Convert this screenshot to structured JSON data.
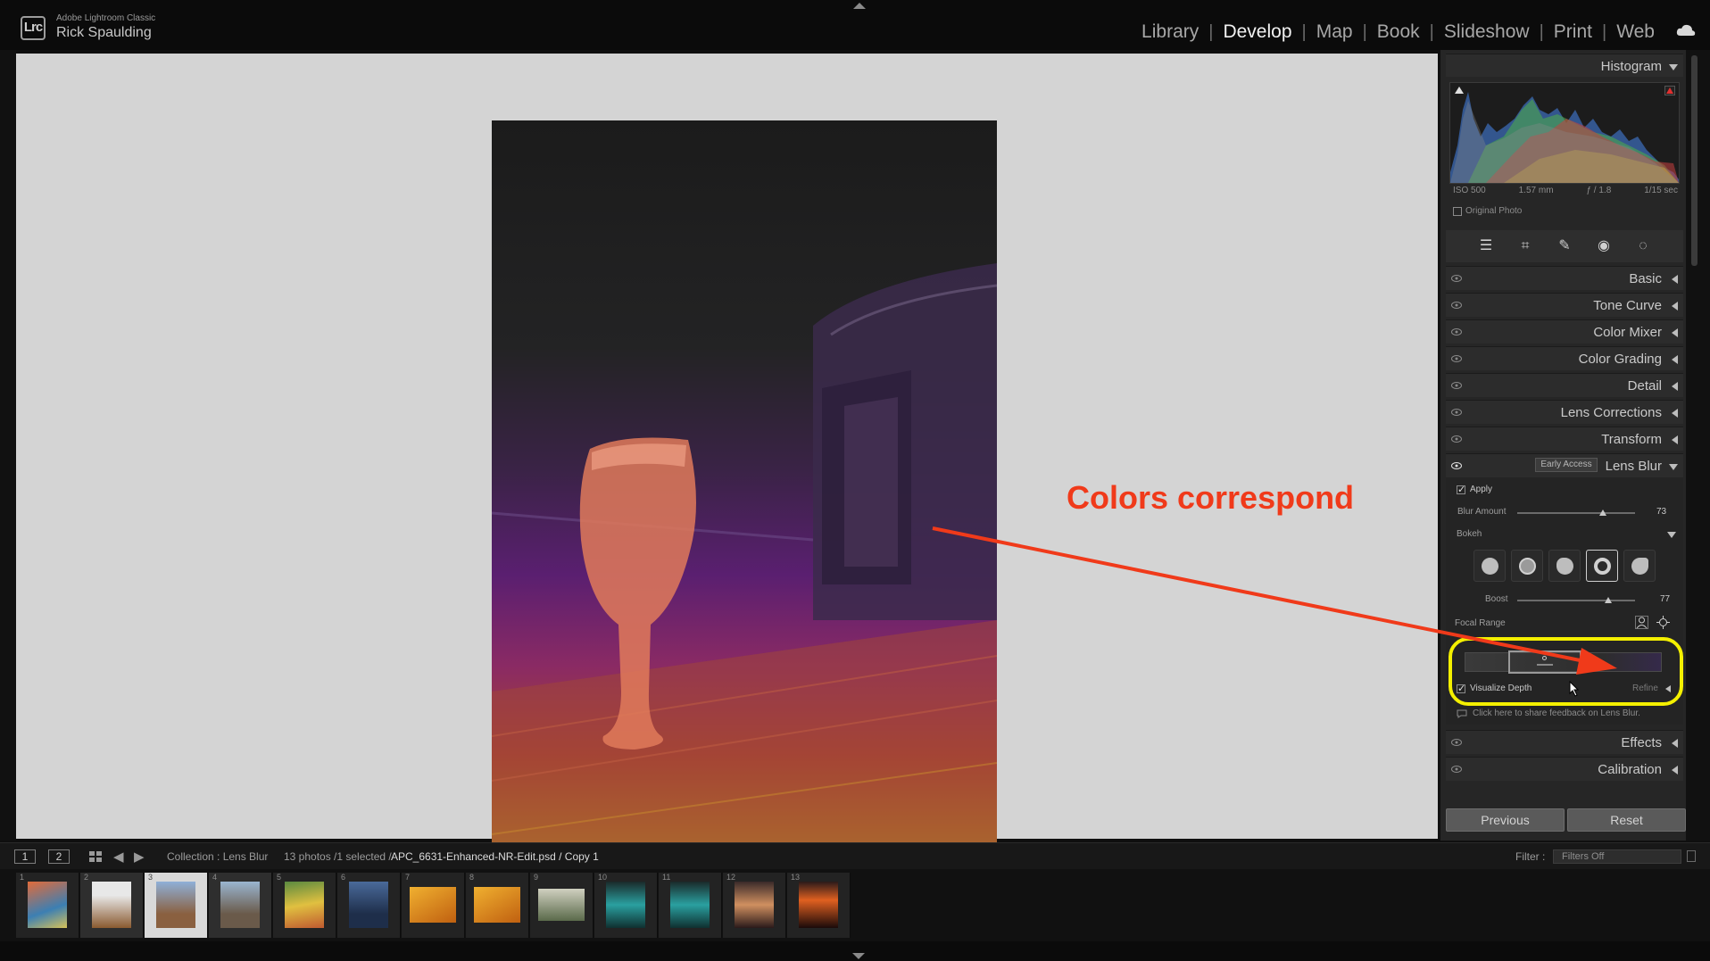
{
  "app": {
    "logo": "Lrc",
    "product": "Adobe Lightroom Classic",
    "user": "Rick Spaulding"
  },
  "modules": [
    {
      "label": "Library",
      "active": false
    },
    {
      "label": "Develop",
      "active": true
    },
    {
      "label": "Map",
      "active": false
    },
    {
      "label": "Book",
      "active": false
    },
    {
      "label": "Slideshow",
      "active": false
    },
    {
      "label": "Print",
      "active": false
    },
    {
      "label": "Web",
      "active": false
    }
  ],
  "histogram": {
    "title": "Histogram",
    "iso": "ISO 500",
    "focal": "1.57 mm",
    "aperture": "ƒ / 1.8",
    "shutter": "1/15 sec",
    "original_photo_label": "Original Photo"
  },
  "panels": {
    "basic": "Basic",
    "tone_curve": "Tone Curve",
    "color_mixer": "Color Mixer",
    "color_grading": "Color Grading",
    "detail": "Detail",
    "lens_corrections": "Lens Corrections",
    "transform": "Transform",
    "lens_blur": "Lens Blur",
    "early_access": "Early Access",
    "effects": "Effects",
    "calibration": "Calibration"
  },
  "lens_blur": {
    "apply_label": "Apply",
    "apply_checked": true,
    "blur_amount_label": "Blur Amount",
    "blur_amount_value": "73",
    "blur_amount": 73,
    "bokeh_label": "Bokeh",
    "boost_label": "Boost",
    "boost_value": "77",
    "boost": 77,
    "focal_range_label": "Focal Range",
    "visualize_depth_label": "Visualize Depth",
    "visualize_depth_checked": true,
    "refine_label": "Refine",
    "feedback_text": "Click here to share feedback on Lens Blur.",
    "selected_bokeh_index": 3
  },
  "buttons": {
    "previous": "Previous",
    "reset": "Reset"
  },
  "annotation": {
    "text": "Colors correspond",
    "color": "#f03a1a",
    "highlight_color": "#f4f000"
  },
  "filmstrip_bar": {
    "view1": "1",
    "view2": "2",
    "collection": "Collection : Lens Blur",
    "count": "13 photos /1 selected /",
    "filename": "APC_6631-Enhanced-NR-Edit.psd / Copy 1",
    "filter_label": "Filter :",
    "filter_value": "Filters Off"
  },
  "filmstrip": {
    "numbers": [
      "1",
      "2",
      "3",
      "4",
      "5",
      "6",
      "7",
      "8",
      "9",
      "10",
      "11",
      "12",
      "13"
    ],
    "selected_index": 2
  }
}
